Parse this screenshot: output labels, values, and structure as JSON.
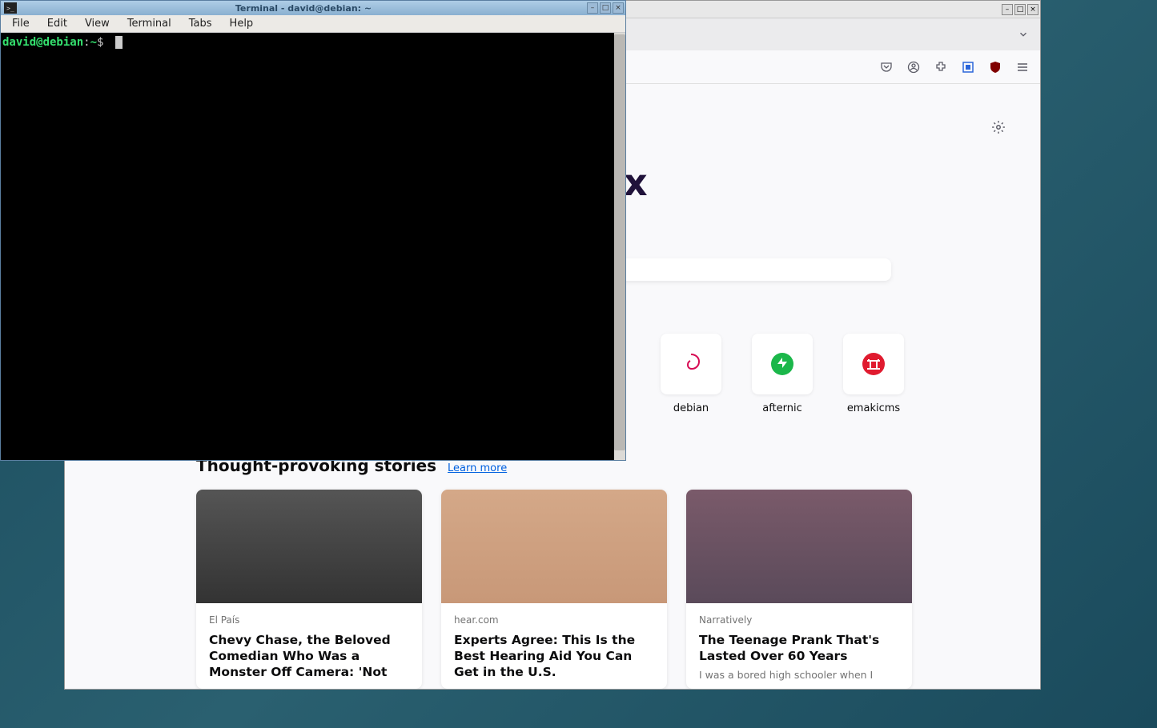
{
  "browser": {
    "toolbar": {
      "icons": [
        "pocket-icon",
        "account-icon",
        "extensions-icon",
        "container-icon",
        "ublock-icon",
        "app-menu-icon"
      ]
    },
    "shortcuts": [
      {
        "label": "debian",
        "icon": "debian-swirl",
        "color": "#d70a53"
      },
      {
        "label": "afternic",
        "icon": "green-circle-arrow",
        "color": "#1bb74a"
      },
      {
        "label": "emakicms",
        "icon": "red-torii",
        "color": "#e01b2f"
      }
    ],
    "stories": {
      "heading": "Thought-provoking stories",
      "learn_more": "Learn more",
      "cards": [
        {
          "source": "El País",
          "title": "Chevy Chase, the Beloved Comedian Who Was a Monster Off Camera: 'Not"
        },
        {
          "source": "hear.com",
          "title": "Experts Agree: This Is the Best Hearing Aid You Can Get in the U.S."
        },
        {
          "source": "Narratively",
          "title": "The Teenage Prank That's Lasted Over 60 Years",
          "sub": "I was a bored high schooler when I"
        }
      ]
    },
    "logo_letter": "x"
  },
  "terminal": {
    "title": "Terminal - david@debian: ~",
    "menus": [
      "File",
      "Edit",
      "View",
      "Terminal",
      "Tabs",
      "Help"
    ],
    "prompt": {
      "user": "david@debian",
      "sep": ":",
      "path": "~",
      "dollar": "$"
    }
  }
}
